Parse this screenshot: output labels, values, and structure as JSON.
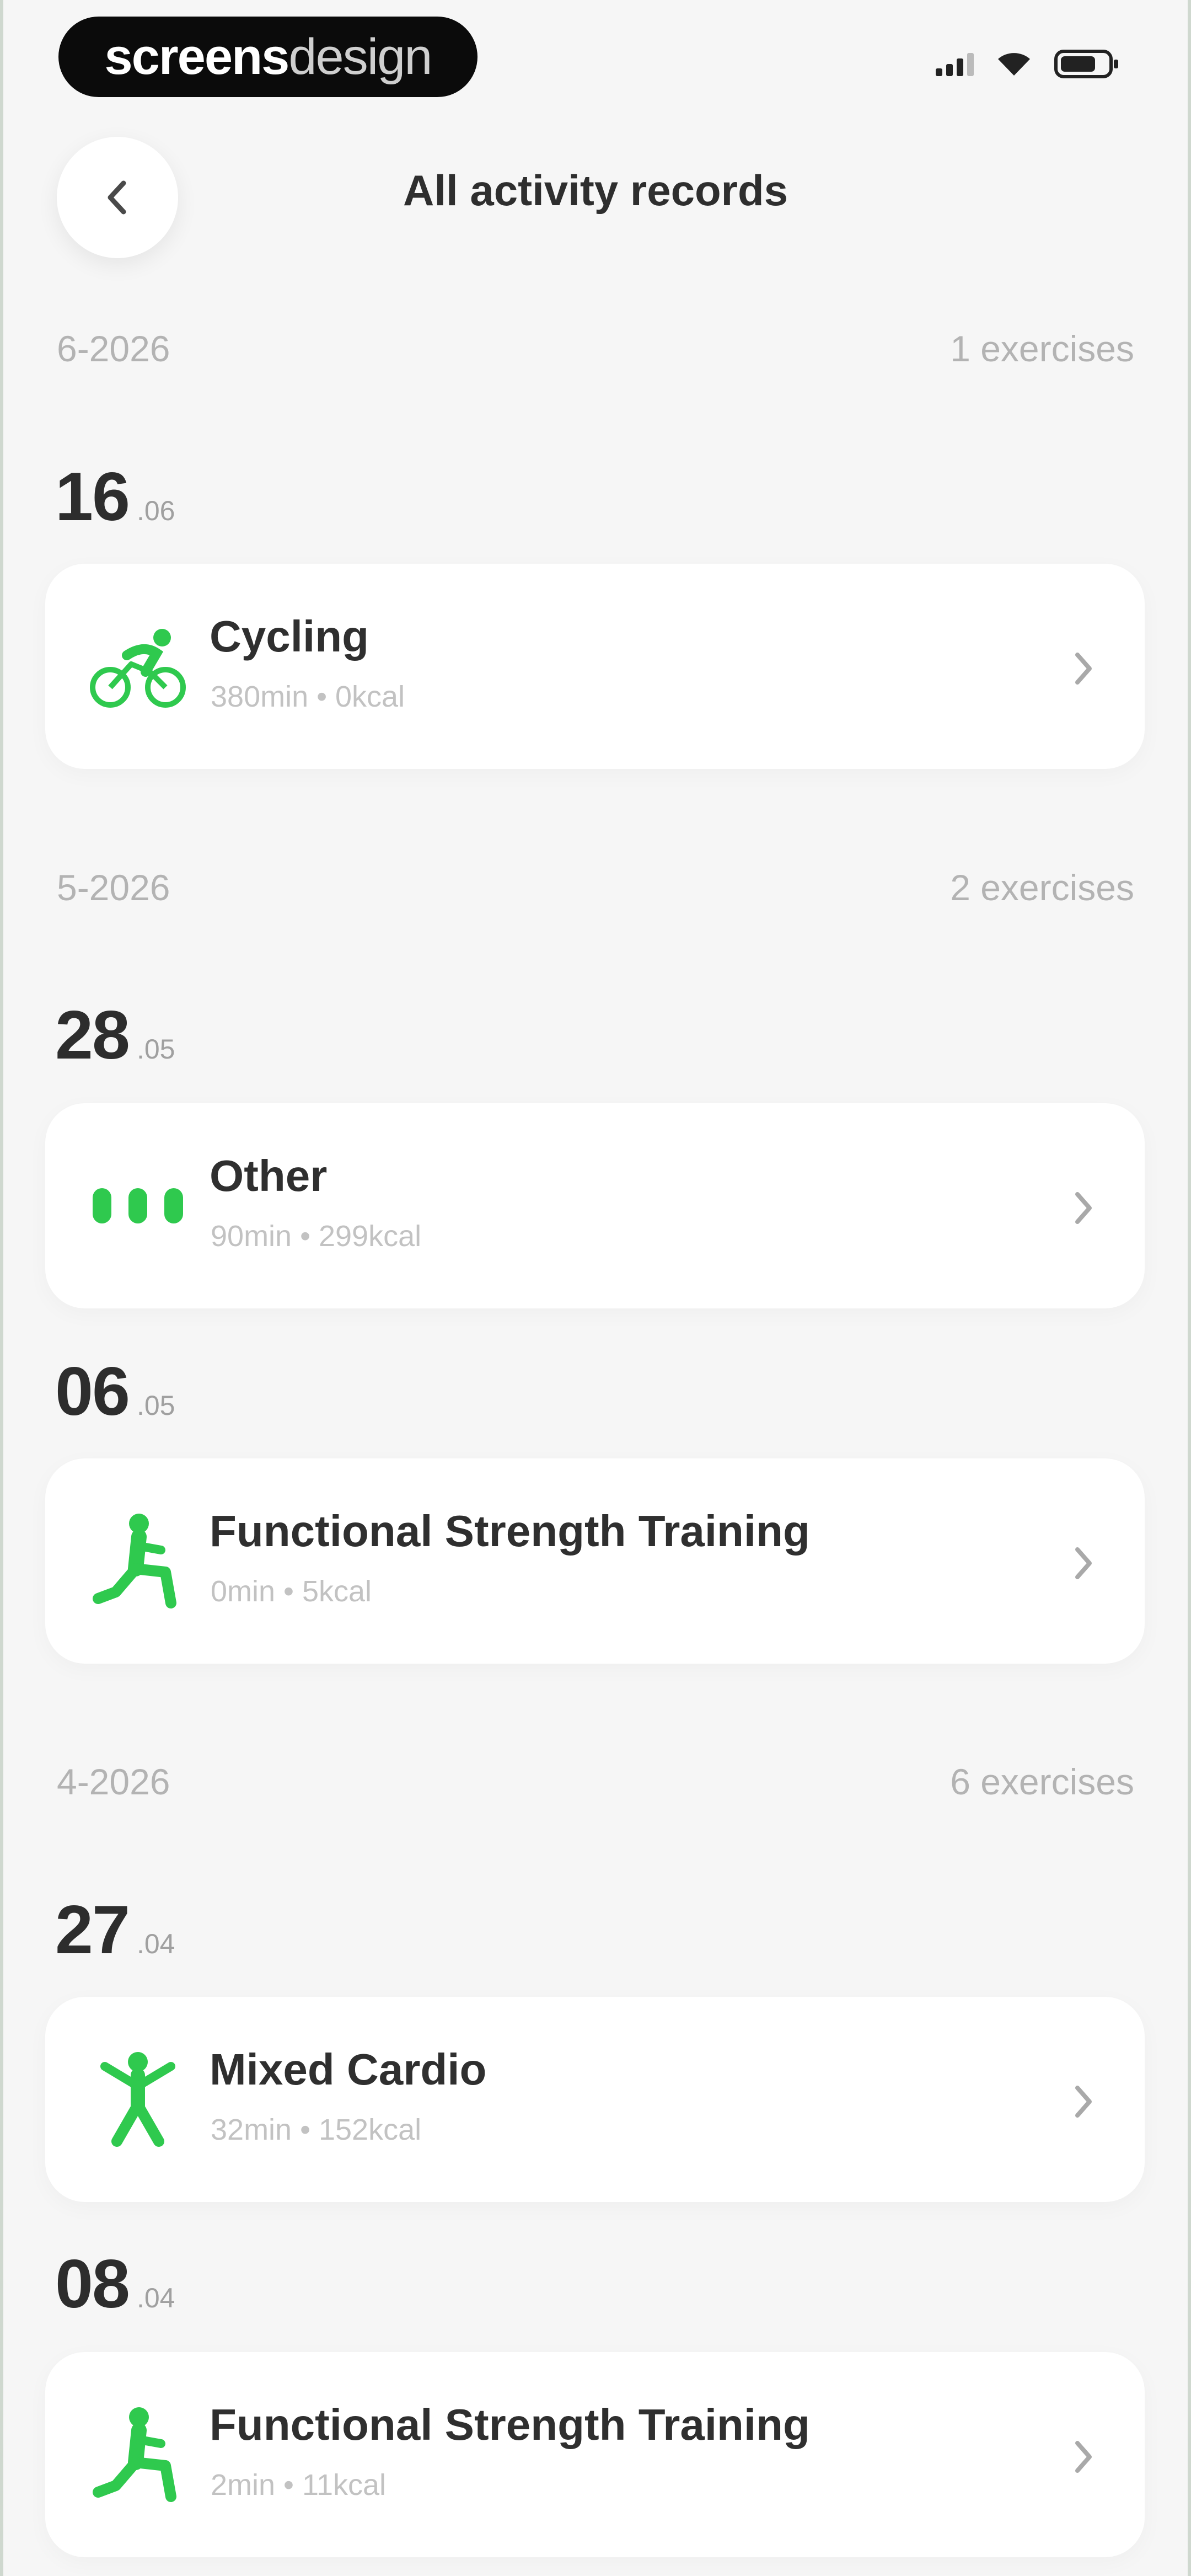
{
  "status_bar": {
    "brand_bold": "screens",
    "brand_light": "design"
  },
  "header": {
    "title": "All activity records",
    "back_icon": "chevron-left-icon"
  },
  "colors": {
    "accent": "#2fc94e",
    "background": "#f6f6f6",
    "card": "#ffffff",
    "muted_text": "#b3b3b3"
  },
  "months": [
    {
      "label": "6-2026",
      "count": "1 exercises",
      "days": [
        {
          "day": "16",
          "month": ".06",
          "activities": [
            {
              "name": "Cycling",
              "meta": "380min • 0kcal",
              "icon": "cycling-icon"
            }
          ]
        }
      ]
    },
    {
      "label": "5-2026",
      "count": "2 exercises",
      "days": [
        {
          "day": "28",
          "month": ".05",
          "activities": [
            {
              "name": "Other",
              "meta": "90min • 299kcal",
              "icon": "other-dots-icon"
            }
          ]
        },
        {
          "day": "06",
          "month": ".05",
          "activities": [
            {
              "name": "Functional Strength Training",
              "meta": "0min • 5kcal",
              "icon": "strength-training-icon"
            }
          ]
        }
      ]
    },
    {
      "label": "4-2026",
      "count": "6 exercises",
      "days": [
        {
          "day": "27",
          "month": ".04",
          "activities": [
            {
              "name": "Mixed Cardio",
              "meta": "32min • 152kcal",
              "icon": "mixed-cardio-icon"
            }
          ]
        },
        {
          "day": "08",
          "month": ".04",
          "activities": [
            {
              "name": "Functional Strength Training",
              "meta": "2min • 11kcal",
              "icon": "strength-training-icon"
            }
          ]
        }
      ]
    }
  ]
}
